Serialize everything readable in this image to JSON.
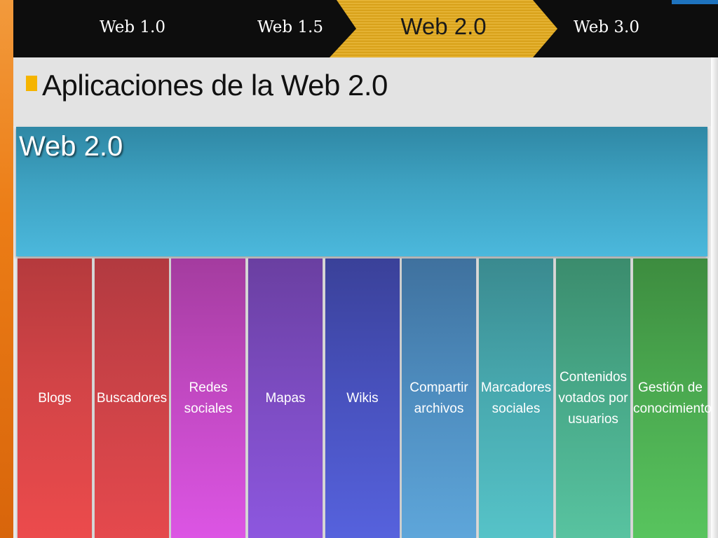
{
  "nav": {
    "items": [
      {
        "label": "Web 1.0"
      },
      {
        "label": "Web 1.5"
      },
      {
        "label": "Web 2.0",
        "active": true
      },
      {
        "label": "Web 3.0"
      }
    ]
  },
  "page": {
    "title": "Aplicaciones de la Web 2.0"
  },
  "diagram": {
    "root_label": "Web 2.0",
    "columns": [
      {
        "label": "Blogs"
      },
      {
        "label": "Buscadores"
      },
      {
        "label": "Redes sociales"
      },
      {
        "label": "Mapas"
      },
      {
        "label": "Wikis"
      },
      {
        "label": "Compartir archivos"
      },
      {
        "label": "Marcadores sociales"
      },
      {
        "label": "Contenidos votados por usuarios"
      },
      {
        "label": "Gestión de conocimiento"
      }
    ]
  },
  "colors": {
    "accent_orange": "#ec7d16",
    "active_tab_gold": "#d9a21b",
    "bullet_yellow": "#f5b400",
    "root_box_blue": "#3ea2c2"
  }
}
